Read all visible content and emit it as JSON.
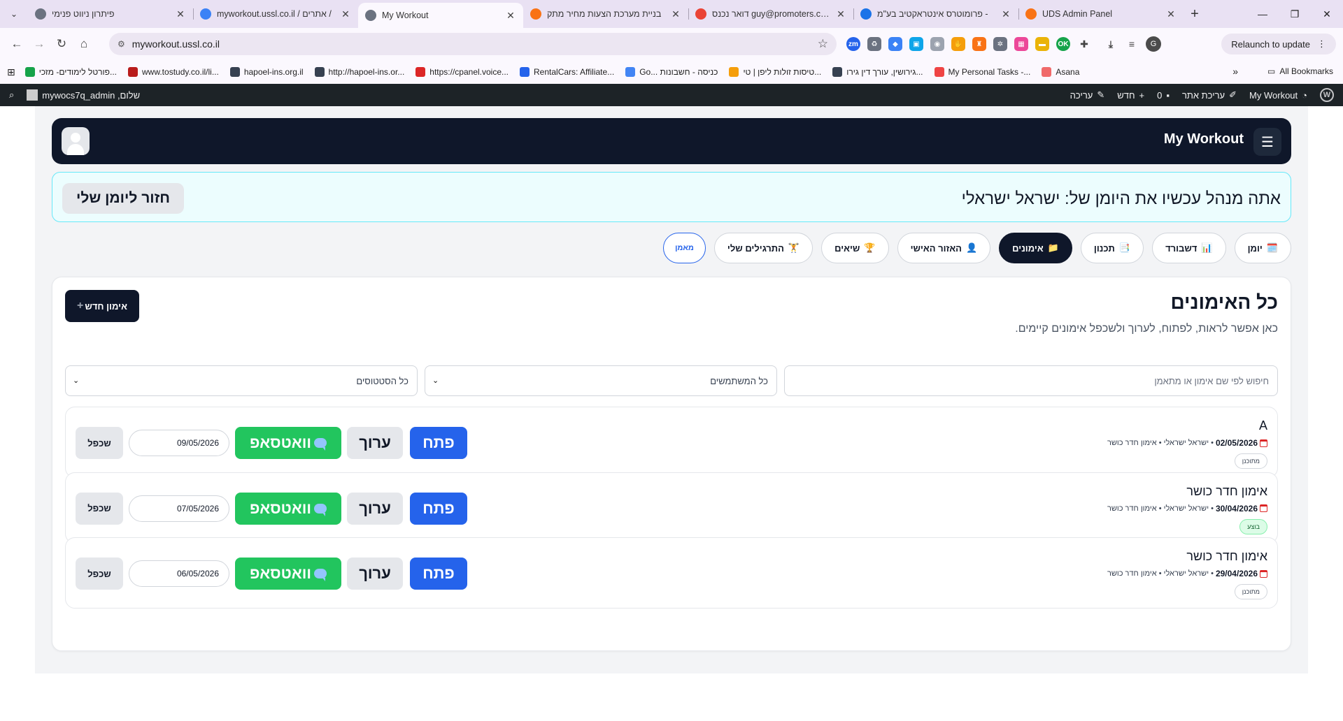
{
  "browser": {
    "tabs": [
      {
        "title": "פיתרון ניווט פנימי",
        "favicon_color": "#6b7280"
      },
      {
        "title": "myworkout.ussl.co.il / אתרים /",
        "favicon_color": "#3b82f6"
      },
      {
        "title": "My Workout",
        "favicon_color": "#6b7280",
        "active": true
      },
      {
        "title": "בניית מערכת הצעות מחיר מתק",
        "favicon_color": "#f97316"
      },
      {
        "title": "דואר נכנס guy@promoters.co.il",
        "favicon_color": "#ea4335"
      },
      {
        "title": "פרומוטרס אינטראקטיב בע\"מ -",
        "favicon_color": "#1a73e8"
      },
      {
        "title": "UDS Admin Panel",
        "favicon_color": "#f97316"
      }
    ],
    "url": "myworkout.ussl.co.il",
    "relaunch_label": "Relaunch to update",
    "profile_initial": "G",
    "bookmarks": [
      {
        "label": "פורטל לימודים- מזכי...",
        "color": "#16a34a"
      },
      {
        "label": "www.tostudy.co.il/li...",
        "color": "#b91c1c"
      },
      {
        "label": "hapoel-ins.org.il",
        "color": "#374151"
      },
      {
        "label": "http://hapoel-ins.or...",
        "color": "#374151"
      },
      {
        "label": "https://cpanel.voice...",
        "color": "#dc2626"
      },
      {
        "label": "RentalCars: Affiliate...",
        "color": "#2563eb"
      },
      {
        "label": "Go... כניסה - חשבונות",
        "color": "#4285f4"
      },
      {
        "label": "טיסות זולות ליפן | טי...",
        "color": "#f59e0b"
      },
      {
        "label": "גירושין, עורך דין גירו...",
        "color": "#374151"
      },
      {
        "label": "My Personal Tasks -...",
        "color": "#ef4444"
      },
      {
        "label": "Asana",
        "color": "#f06a6a"
      }
    ],
    "all_bookmarks_label": "All Bookmarks"
  },
  "wpbar": {
    "greeting": "שלום, mywocs7q_admin",
    "site_name": "My Workout",
    "edit_site": "עריכת אתר",
    "comments_count": "0",
    "new_label": "חדש",
    "edit_label": "עריכה"
  },
  "app": {
    "brand": "My Workout",
    "notice": "אתה מנהל עכשיו את היומן של: ישראל ישראלי",
    "back_label": "חזור ליומן שלי",
    "nav": [
      {
        "label": "יומן",
        "icon": "🗓️"
      },
      {
        "label": "דשבורד",
        "icon": "📊"
      },
      {
        "label": "תכנון",
        "icon": "📑"
      },
      {
        "label": "אימונים",
        "icon": "📁",
        "active": true
      },
      {
        "label": "האזור האישי",
        "icon": "👤"
      },
      {
        "label": "שיאים",
        "icon": "🏆"
      },
      {
        "label": "התרגילים שלי",
        "icon": "🏋️"
      },
      {
        "label": "מאמן",
        "icon": ""
      }
    ],
    "section_title": "כל האימונים",
    "section_subtitle": "כאן אפשר לראות, לפתוח, לערוך ולשכפל אימונים קיימים.",
    "new_workout_label": "אימון חדש",
    "search_placeholder": "חיפוש לפי שם אימון או מתאמן",
    "users_filter": "כל המשתמשים",
    "status_filter": "כל הסטטוסים",
    "actions": {
      "open": "פתח",
      "edit": "ערוך",
      "whatsapp": "וואטסאפ",
      "duplicate": "שכפל"
    },
    "workouts": [
      {
        "title": "A",
        "date": "02/05/2026",
        "meta": "ישראל ישראלי • אימון חדר כושר",
        "status": "מתוכנן",
        "dup_date": "09/05/2026"
      },
      {
        "title": "אימון חדר כושר",
        "date": "30/04/2026",
        "meta": "ישראל ישראלי • אימון חדר כושר",
        "status": "בוצע",
        "dup_date": "07/05/2026"
      },
      {
        "title": "אימון חדר כושר",
        "date": "29/04/2026",
        "meta": "ישראל ישראלי • אימון חדר כושר",
        "status": "מתוכנן",
        "dup_date": "06/05/2026"
      }
    ]
  }
}
